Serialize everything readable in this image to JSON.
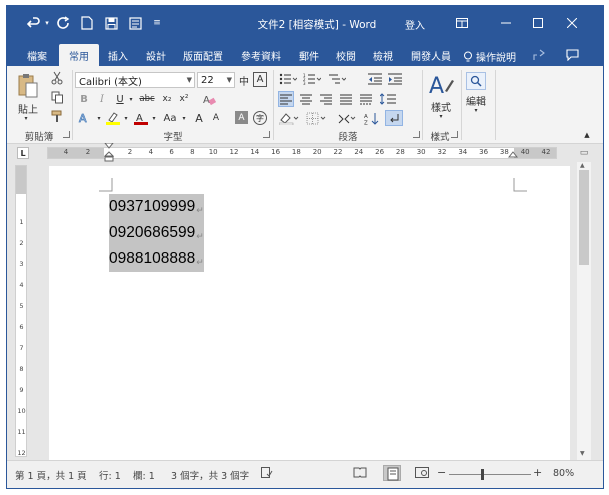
{
  "window": {
    "title": "文件2 [相容模式]  -  Word",
    "signin": "登入",
    "quick_access": {
      "undo_icon": "undo-icon",
      "redo_icon": "redo-icon",
      "new_icon": "new-document-icon",
      "save_icon": "save-icon",
      "print_preview_icon": "print-preview-icon",
      "customize_icon": "customize-icon"
    }
  },
  "tabs": [
    "檔案",
    "常用",
    "插入",
    "設計",
    "版面配置",
    "參考資料",
    "郵件",
    "校閱",
    "檢視",
    "開發人員"
  ],
  "active_tab": "常用",
  "tell_me": "操作說明",
  "ribbon": {
    "clipboard": {
      "label": "剪貼簿",
      "paste": "貼上"
    },
    "font": {
      "label": "字型",
      "font_name": "Calibri (本文)",
      "font_size": "22",
      "phonetic": "中",
      "charborder": "A",
      "bold": "B",
      "italic": "I",
      "underline": "U",
      "strike": "abc",
      "subscript": "x₂",
      "superscript": "x²",
      "grow": "A",
      "shrink": "A",
      "case": "Aa",
      "shade": "A",
      "enclose": "字",
      "font_color_hex": "#c00000",
      "highlight_hex": "#ffff00"
    },
    "paragraph": {
      "label": "段落"
    },
    "styles": {
      "label": "樣式",
      "button": "樣式",
      "style_letter": "A"
    },
    "editing": {
      "label": "",
      "button": "編輯"
    }
  },
  "ruler": {
    "h_ticks": [
      "4",
      "2",
      "2",
      "4",
      "6",
      "8",
      "10",
      "12",
      "14",
      "16",
      "18",
      "20",
      "22",
      "24",
      "26",
      "28",
      "30",
      "32",
      "34",
      "36",
      "38",
      "40",
      "42"
    ],
    "v_ticks": [
      "1",
      "2",
      "3",
      "4",
      "5",
      "6",
      "7",
      "8",
      "9",
      "10",
      "11",
      "12"
    ],
    "corner_label": "L"
  },
  "document": {
    "lines": [
      "0937109999",
      "0920686599",
      "0988108888"
    ],
    "paragraph_mark": "↵",
    "selection_hex": "#c4c4c4"
  },
  "status_bar": {
    "page": "第 1 頁，共 1 頁",
    "line": "行: 1",
    "column": "欄: 1",
    "words": "3 個字，共 3 個字",
    "zoom": "80%",
    "minus": "−",
    "plus": "+"
  },
  "colors": {
    "brand": "#2b579a",
    "ribbon_bg": "#f3f3f3",
    "doc_bg": "#e6e6e6"
  }
}
